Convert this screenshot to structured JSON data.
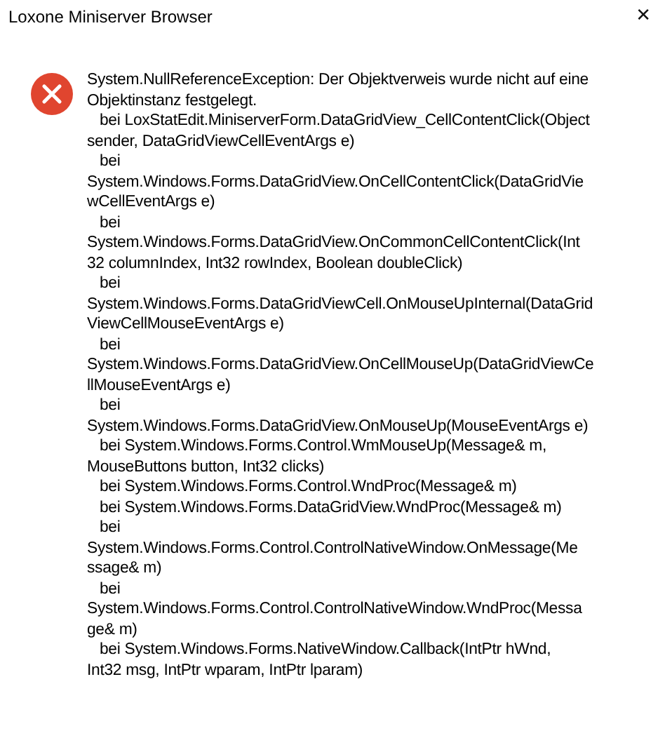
{
  "window": {
    "title": "Loxone Miniserver Browser",
    "close": "✕"
  },
  "message": {
    "lines": [
      {
        "text": "System.NullReferenceException: Der Objektverweis wurde nicht auf eine",
        "indent": false
      },
      {
        "text": "Objektinstanz festgelegt.",
        "indent": false
      },
      {
        "text": "bei LoxStatEdit.MiniserverForm.DataGridView_CellContentClick(Object",
        "indent": true
      },
      {
        "text": "sender, DataGridViewCellEventArgs e)",
        "indent": false
      },
      {
        "text": "bei",
        "indent": true
      },
      {
        "text": "System.Windows.Forms.DataGridView.OnCellContentClick(DataGridVie",
        "indent": false
      },
      {
        "text": "wCellEventArgs e)",
        "indent": false
      },
      {
        "text": "bei",
        "indent": true
      },
      {
        "text": "System.Windows.Forms.DataGridView.OnCommonCellContentClick(Int",
        "indent": false
      },
      {
        "text": "32 columnIndex, Int32 rowIndex, Boolean doubleClick)",
        "indent": false
      },
      {
        "text": "bei",
        "indent": true
      },
      {
        "text": "System.Windows.Forms.DataGridViewCell.OnMouseUpInternal(DataGrid",
        "indent": false
      },
      {
        "text": "ViewCellMouseEventArgs e)",
        "indent": false
      },
      {
        "text": "bei",
        "indent": true
      },
      {
        "text": "System.Windows.Forms.DataGridView.OnCellMouseUp(DataGridViewCe",
        "indent": false
      },
      {
        "text": "llMouseEventArgs e)",
        "indent": false
      },
      {
        "text": "bei",
        "indent": true
      },
      {
        "text": "System.Windows.Forms.DataGridView.OnMouseUp(MouseEventArgs e)",
        "indent": false
      },
      {
        "text": "bei System.Windows.Forms.Control.WmMouseUp(Message& m,",
        "indent": true
      },
      {
        "text": "MouseButtons button, Int32 clicks)",
        "indent": false
      },
      {
        "text": "bei System.Windows.Forms.Control.WndProc(Message& m)",
        "indent": true
      },
      {
        "text": "bei System.Windows.Forms.DataGridView.WndProc(Message& m)",
        "indent": true
      },
      {
        "text": "bei",
        "indent": true
      },
      {
        "text": "System.Windows.Forms.Control.ControlNativeWindow.OnMessage(Me",
        "indent": false
      },
      {
        "text": "ssage& m)",
        "indent": false
      },
      {
        "text": "bei",
        "indent": true
      },
      {
        "text": "System.Windows.Forms.Control.ControlNativeWindow.WndProc(Messa",
        "indent": false
      },
      {
        "text": "ge& m)",
        "indent": false
      },
      {
        "text": "bei System.Windows.Forms.NativeWindow.Callback(IntPtr hWnd,",
        "indent": true
      },
      {
        "text": "Int32 msg, IntPtr wparam, IntPtr lparam)",
        "indent": false
      }
    ]
  }
}
